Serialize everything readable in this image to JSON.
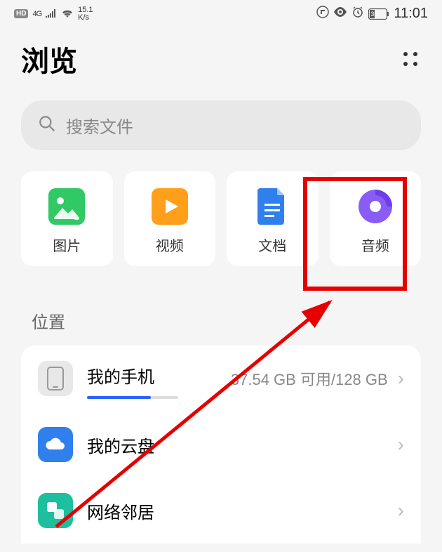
{
  "statusBar": {
    "hd": "HD",
    "net": "4G",
    "speed_val": "15.1",
    "speed_unit": "K/s",
    "battery": "30",
    "time": "11:01"
  },
  "header": {
    "title": "浏览"
  },
  "search": {
    "placeholder": "搜索文件"
  },
  "categories": [
    {
      "key": "images",
      "label": "图片"
    },
    {
      "key": "videos",
      "label": "视频"
    },
    {
      "key": "docs",
      "label": "文档"
    },
    {
      "key": "audio",
      "label": "音频"
    }
  ],
  "sections": {
    "location_header": "位置"
  },
  "locations": {
    "phone": {
      "label": "我的手机",
      "info": "37.54 GB 可用/128 GB"
    },
    "cloud": {
      "label": "我的云盘"
    },
    "network": {
      "label": "网络邻居"
    }
  }
}
